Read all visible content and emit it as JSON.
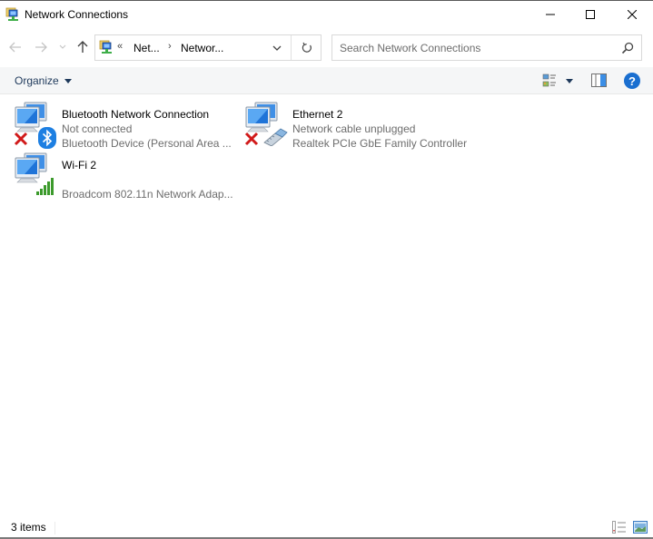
{
  "window": {
    "title": "Network Connections",
    "icon": "network-connections-icon",
    "controls": {
      "minimize_icon": "minimize-icon",
      "maximize_icon": "maximize-icon",
      "close_icon": "close-icon"
    }
  },
  "navigation": {
    "back_icon": "arrow-left-icon",
    "forward_icon": "arrow-right-icon",
    "recent_icon": "chevron-down-icon",
    "up_icon": "arrow-up-icon",
    "address": {
      "overflow_chevron": "«",
      "breadcrumbs": [
        "Net...",
        "Networ..."
      ],
      "separator": "›",
      "dropdown_icon": "chevron-down-icon",
      "refresh_icon": "refresh-icon"
    },
    "search": {
      "placeholder": "Search Network Connections",
      "value": "",
      "icon": "search-icon"
    }
  },
  "command_bar": {
    "organize_label": "Organize",
    "change_view_icon": "change-view-icon",
    "preview_pane_icon": "preview-pane-icon",
    "help_label": "?"
  },
  "connections": [
    {
      "name": "Bluetooth Network Connection",
      "status": "Not connected",
      "device": "Bluetooth Device (Personal Area ...",
      "overlay": "bluetooth",
      "disconnected": true
    },
    {
      "name": "Ethernet 2",
      "status": "Network cable unplugged",
      "device": "Realtek PCIe GbE Family Controller",
      "overlay": "ethernet-cable",
      "disconnected": true
    },
    {
      "name": "Wi-Fi 2",
      "status": "",
      "device": "Broadcom 802.11n Network Adap...",
      "overlay": "wifi-signal-bars",
      "disconnected": false
    }
  ],
  "status_bar": {
    "item_count": "3 items",
    "details_view_icon": "details-view-icon",
    "large_icons_view_icon": "large-icons-view-icon"
  },
  "colors": {
    "command_bar_bg": "#f5f6f7",
    "organize_text": "#1e395b",
    "secondary_text": "#6d6d6d",
    "help_blue": "#1a6fd0",
    "bluetooth_blue": "#1d7fe2",
    "error_red": "#d11a1a",
    "wifi_green": "#3c9a2c"
  }
}
